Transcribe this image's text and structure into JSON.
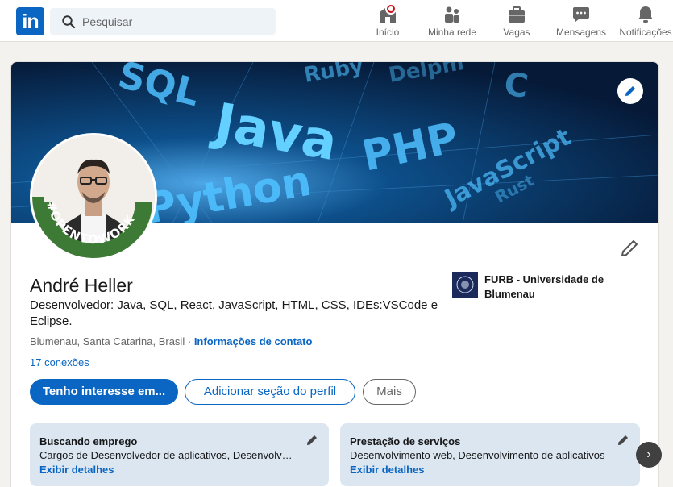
{
  "nav": {
    "logo_text": "in",
    "search_placeholder": "Pesquisar",
    "items": [
      {
        "label": "Início",
        "icon": "home-icon"
      },
      {
        "label": "Minha rede",
        "icon": "network-icon"
      },
      {
        "label": "Vagas",
        "icon": "briefcase-icon"
      },
      {
        "label": "Mensagens",
        "icon": "messaging-icon"
      },
      {
        "label": "Notificações",
        "icon": "bell-icon"
      }
    ]
  },
  "banner": {
    "words": [
      "SQL",
      "Java",
      "PHP",
      "Ruby",
      "Python",
      "JavaScript",
      "Delphi",
      "C",
      "Rust"
    ]
  },
  "avatar": {
    "frame_text": "#OPENTOWORK"
  },
  "profile": {
    "name": "André Heller",
    "headline": "Desenvolvedor: Java, SQL, React, JavaScript, HTML, CSS, IDEs:VSCode e Eclipse.",
    "location": "Blumenau, Santa Catarina, Brasil",
    "separator": "·",
    "contact_link": "Informações de contato",
    "connections": "17 conexões"
  },
  "education": {
    "name": "FURB - Universidade de Blumenau"
  },
  "actions": {
    "primary": "Tenho interesse em...",
    "add_section": "Adicionar seção do perfil",
    "more": "Mais"
  },
  "info_boxes": [
    {
      "title": "Buscando emprego",
      "description": "Cargos de Desenvolvedor de aplicativos, Desenvolvedor web",
      "link": "Exibir detalhes"
    },
    {
      "title": "Prestação de serviços",
      "description": "Desenvolvimento web, Desenvolvimento de aplicativos",
      "link": "Exibir detalhes"
    }
  ],
  "carousel": {
    "next_glyph": "›"
  },
  "colors": {
    "brand": "#0a66c2",
    "background": "#f3f2ef",
    "notification": "#cc1016",
    "open_to_work": "#3c7a35",
    "info_box": "#dce6f1"
  }
}
